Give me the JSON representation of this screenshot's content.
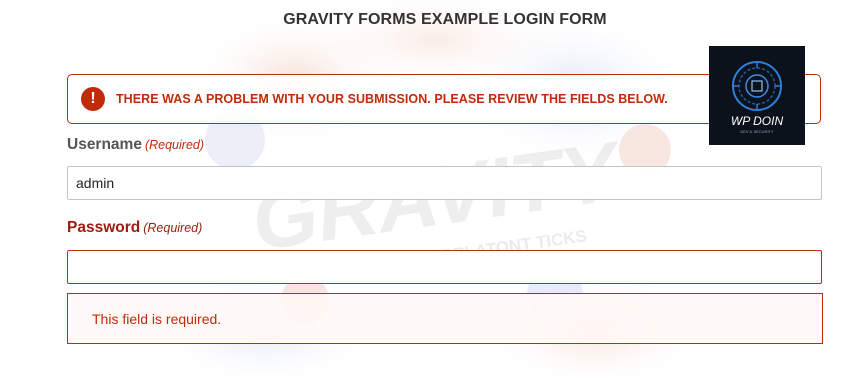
{
  "form": {
    "title": "GRAVITY FORMS EXAMPLE LOGIN FORM",
    "error_icon": "!",
    "error_message": "THERE WAS A PROBLEM WITH YOUR SUBMISSION. PLEASE REVIEW THE FIELDS BELOW.",
    "username": {
      "label": "Username",
      "required": "(Required)",
      "value": "admin"
    },
    "password": {
      "label": "Password",
      "required": "(Required)",
      "value": "",
      "validation": "This field is required."
    }
  },
  "logo": {
    "text": "WP DOIN",
    "tagline": "DEV & SECURITY"
  },
  "watermark": {
    "word": "GRAVITY",
    "subtext": "FOPMSC DIC POPLATONT TICKS"
  },
  "colors": {
    "error": "#c02b0a",
    "title": "#333333",
    "label": "#555555",
    "logo_bg": "#0c121c",
    "logo_accent": "#2f7fd6"
  }
}
